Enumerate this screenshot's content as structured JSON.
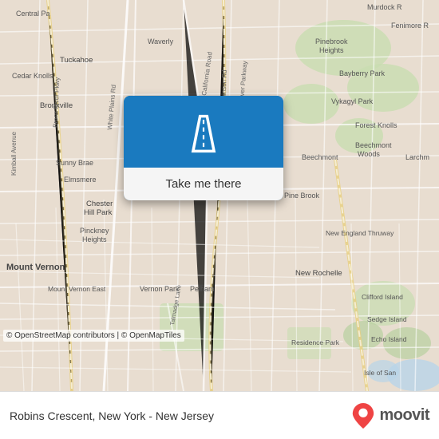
{
  "map": {
    "attribution": "© OpenStreetMap contributors | © OpenMapTiles",
    "center": {
      "lat": 40.93,
      "lng": -73.85
    },
    "zoom": 13
  },
  "popup": {
    "button_label": "Take me there",
    "icon_name": "road-icon"
  },
  "bottom_bar": {
    "location_text": "Robins Crescent, New York - New Jersey",
    "brand_name": "moovit"
  },
  "labels": [
    "Central Pa",
    "Murdock R",
    "Fenimore R",
    "Waverly",
    "Pinebrook Heights",
    "Tuckahoe",
    "Bayberry Park",
    "Cedar Knolls",
    "Vykagyl Park",
    "Bronxville",
    "Forest Knolls",
    "Beechmont Woods",
    "Beechmont",
    "Larchm",
    "Sunny Brae",
    "Elmsmere",
    "Chester Hill Park",
    "Pine Brook",
    "Pinckney Heights",
    "New England Thruway",
    "Mount Vernon",
    "New Rochelle",
    "Mount Vernon East",
    "Vernon Park",
    "Pelham",
    "Clifford Island",
    "Sedge Island",
    "Echo Island",
    "Residence Park",
    "Isle of San",
    "White Plains Rd",
    "Hutchinson River Pkwy",
    "California Road",
    "Bronx River Pkwy",
    "Talmadge Lane",
    "Avenue"
  ]
}
